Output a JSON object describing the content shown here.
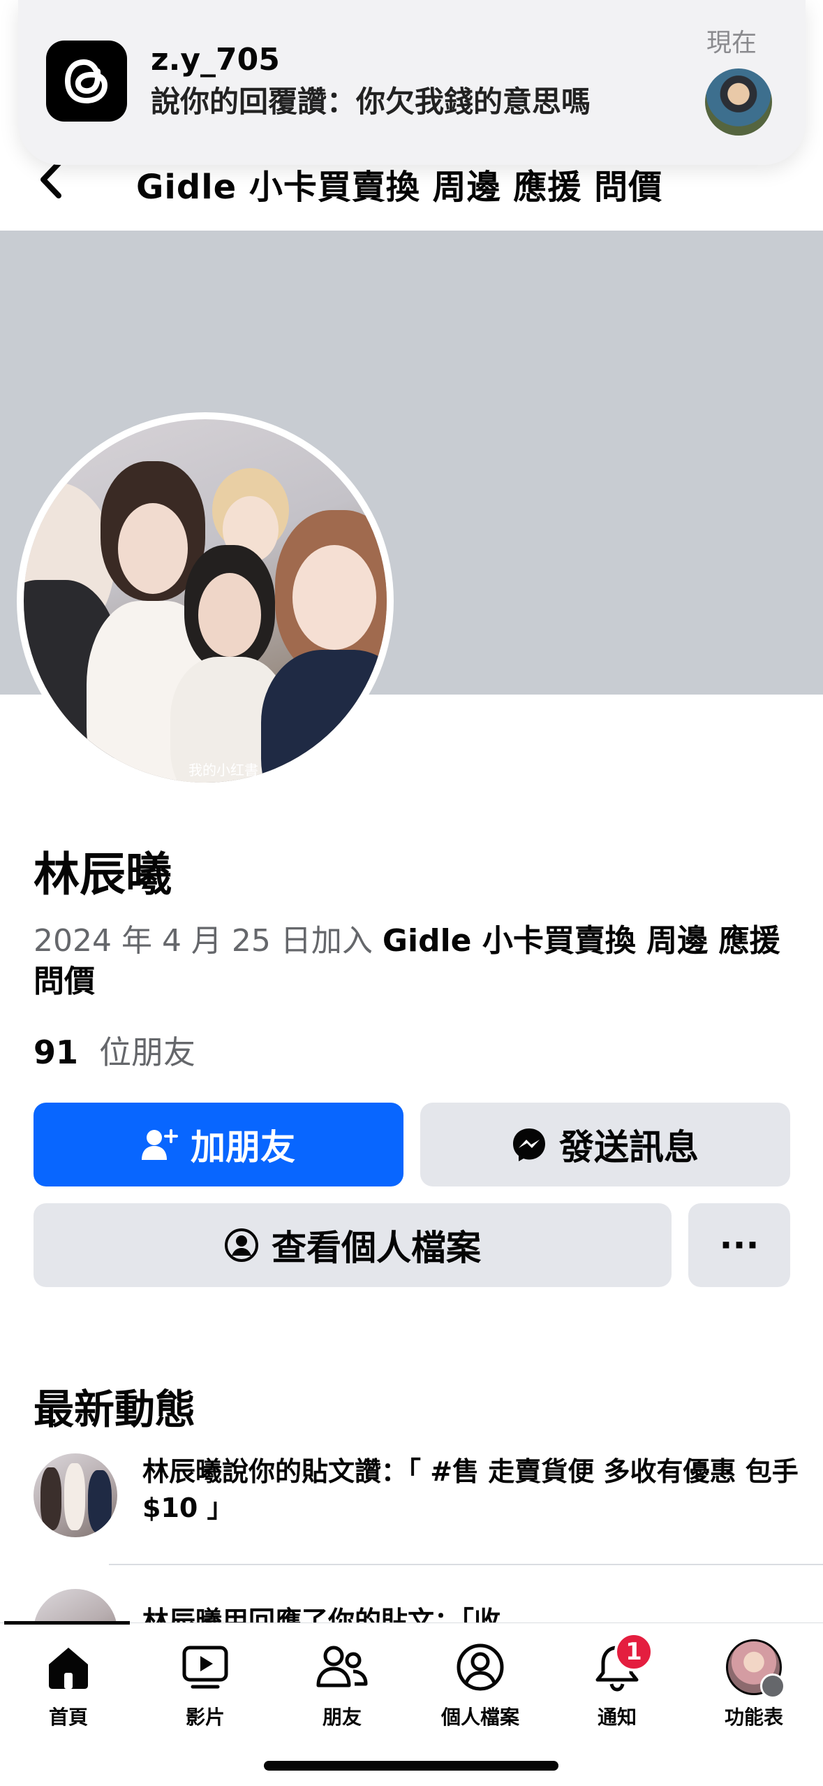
{
  "notification": {
    "app_icon": "threads-icon",
    "username": "z.y_705",
    "message": "說你的回覆讚：你欠我錢的意思嗎",
    "time": "現在"
  },
  "header": {
    "title": "Gidle 小卡買賣換 周邊 應援 問價"
  },
  "profile": {
    "name": "林辰曦",
    "avatar_watermark": "我的小红書",
    "joined_prefix": "2024 年 4 月 25 日加入",
    "joined_group": "Gidle 小卡買賣換 周邊 應援 問價",
    "friends_count": "91",
    "friends_label": "位朋友"
  },
  "actions": {
    "add_friend": "加朋友",
    "send_message": "發送訊息",
    "view_profile": "查看個人檔案",
    "more": "···"
  },
  "recent_activity": {
    "title": "最新動態",
    "items": [
      {
        "text": "林辰曦說你的貼文讚：「 #售 走賣貨便 多收有優惠 包手$10 」"
      },
      {
        "text": "林辰曦用回應了你的貼文：「收"
      }
    ]
  },
  "tabbar": {
    "items": [
      {
        "label": "首頁",
        "icon": "home-icon"
      },
      {
        "label": "影片",
        "icon": "video-icon"
      },
      {
        "label": "朋友",
        "icon": "friends-icon"
      },
      {
        "label": "個人檔案",
        "icon": "profile-icon"
      },
      {
        "label": "通知",
        "icon": "bell-icon",
        "badge": "1"
      },
      {
        "label": "功能表",
        "icon": "menu-avatar-icon"
      }
    ]
  },
  "colors": {
    "primary": "#0866ff",
    "button_gray": "#e4e6eb",
    "secondary_text": "#65676b",
    "badge_red": "#e41e3f"
  }
}
